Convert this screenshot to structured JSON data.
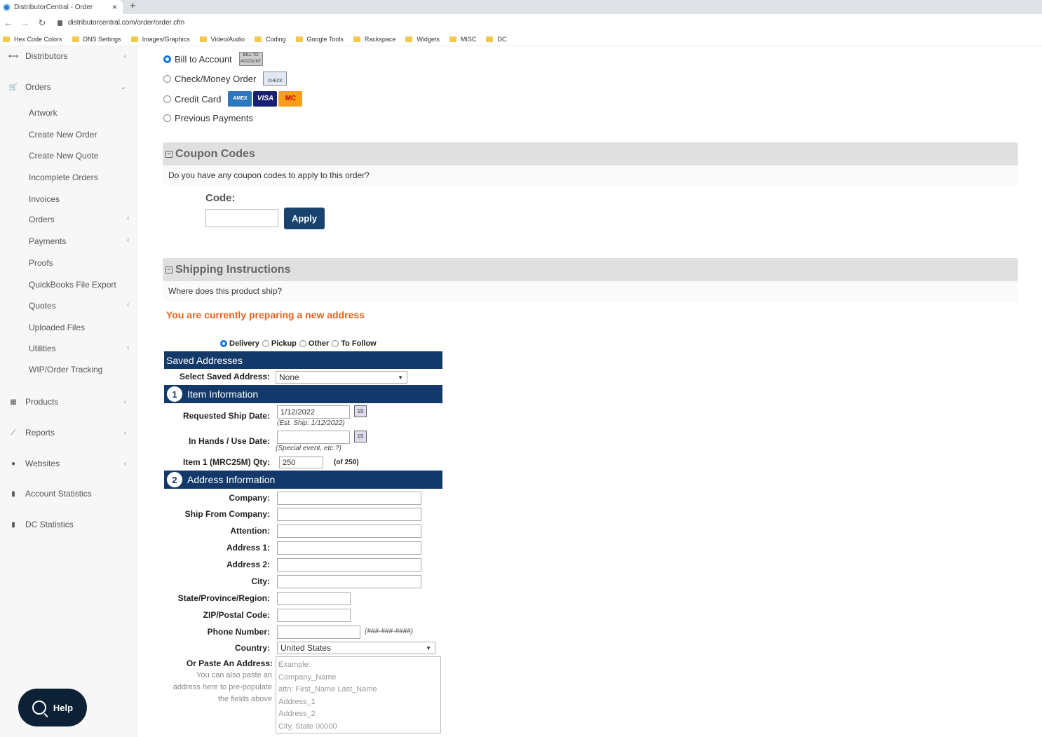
{
  "browser": {
    "tab_title": "DistributorCentral - Order",
    "tab_close": "×",
    "new_tab": "+",
    "url": "distributorcentral.com/order/order.cfm",
    "bookmarks": [
      "Hex Code Colors",
      "DNS Settings",
      "Images/Graphics",
      "Video/Audio",
      "Coding",
      "Google Tools",
      "Rackspace",
      "Widgets",
      "MISC",
      "DC"
    ]
  },
  "sidebar": {
    "distributors": "Distributors",
    "orders": "Orders",
    "sub_items": [
      "Artwork",
      "Create New Order",
      "Create New Quote",
      "Incomplete Orders",
      "Invoices",
      "Orders",
      "Payments",
      "Proofs",
      "QuickBooks File Export",
      "Quotes",
      "Uploaded Files",
      "Utilities",
      "WIP/Order Tracking"
    ],
    "products": "Products",
    "reports": "Reports",
    "websites": "Websites",
    "account_statistics": "Account Statistics",
    "dc_statistics": "DC Statistics",
    "help": "Help"
  },
  "payment": {
    "bill_to_account": "Bill to Account",
    "bill_icon": "BILL TO ACCOUNT",
    "check_money_order": "Check/Money Order",
    "check_icon": "CHECK",
    "credit_card": "Credit Card",
    "cards": [
      "AMEX",
      "VISA",
      "MC"
    ],
    "previous_payments": "Previous Payments",
    "selected": "Bill to Account"
  },
  "coupon": {
    "title": "Coupon Codes",
    "question": "Do you have any coupon codes to apply to this order?",
    "code_label": "Code:",
    "code_value": "",
    "apply": "Apply"
  },
  "shipping": {
    "title": "Shipping Instructions",
    "question": "Where does this product ship?",
    "notice": "You are currently preparing a new address",
    "methods": [
      "Delivery",
      "Pickup",
      "Other",
      "To Follow"
    ],
    "selected_method": "Delivery",
    "saved_addresses_title": "Saved Addresses",
    "select_saved_label": "Select Saved Address:",
    "select_saved_value": "None",
    "item_info_num": "1",
    "item_info_title": "Item Information",
    "req_ship_label": "Requested Ship Date:",
    "req_ship_value": "1/12/2022",
    "req_ship_hint": "(Est. Ship: 1/12/2022)",
    "in_hands_label": "In Hands / Use Date:",
    "in_hands_value": "",
    "in_hands_hint": "(Special event, etc.?)",
    "qty_label": "Item 1 (MRC25M) Qty:",
    "qty_value": "250",
    "qty_of": "(of 250)",
    "address_info_num": "2",
    "address_info_title": "Address Information",
    "company_label": "Company:",
    "ship_from_label": "Ship From Company:",
    "attention_label": "Attention:",
    "address1_label": "Address 1:",
    "address2_label": "Address 2:",
    "city_label": "City:",
    "state_label": "State/Province/Region:",
    "zip_label": "ZIP/Postal Code:",
    "phone_label": "Phone Number:",
    "phone_hint": "(###-###-####)",
    "country_label": "Country:",
    "country_value": "United States",
    "paste_label": "Or Paste An Address:",
    "paste_note": "You can also paste an address here to pre-populate the fields above",
    "paste_placeholder": "Example:\nCompany_Name\nattn: First_Name Last_Name\nAddress_1\nAddress_2\nCity, State 00000"
  },
  "colors": {
    "header_blue": "#12396a",
    "apply_blue": "#18436e",
    "notice_orange": "#e0651d",
    "help_navy": "#0d2136"
  }
}
